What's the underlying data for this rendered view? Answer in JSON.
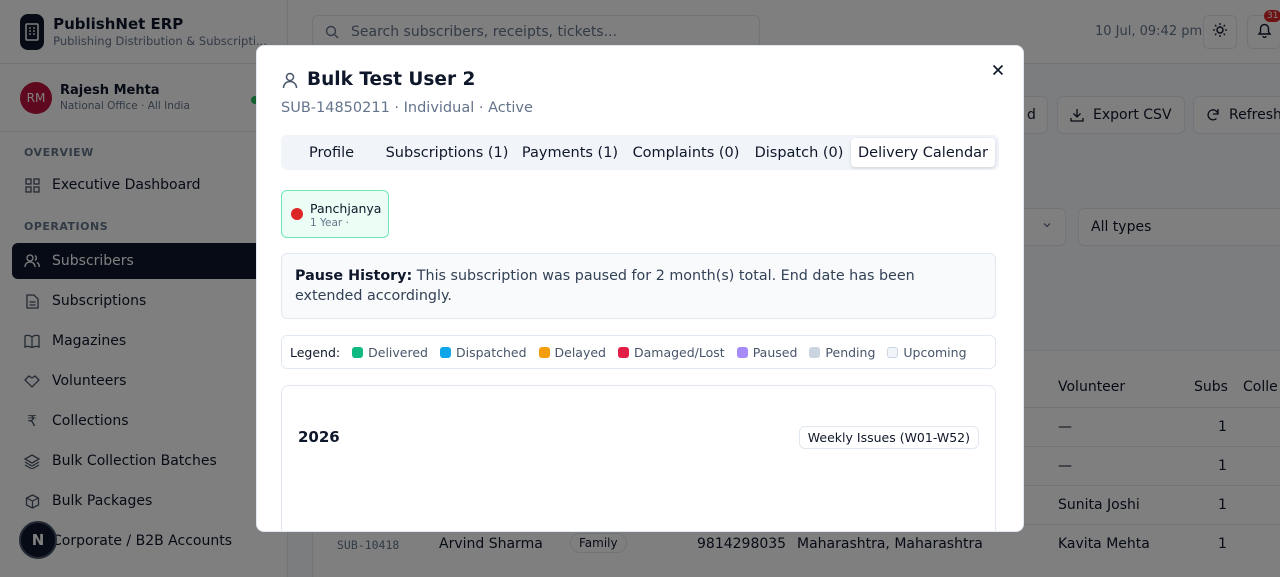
{
  "app": {
    "name": "PublishNet ERP",
    "subtitle": "Publishing Distribution & Subscripti..."
  },
  "user": {
    "initials": "RM",
    "name": "Rajesh Mehta",
    "role": "National Office · All India"
  },
  "sidebar": {
    "overview_label": "OVERVIEW",
    "operations_label": "OPERATIONS",
    "items": [
      {
        "label": "Executive Dashboard",
        "icon": "dashboard-icon"
      },
      {
        "label": "Subscribers",
        "icon": "users-icon",
        "active": true
      },
      {
        "label": "Subscriptions",
        "icon": "document-icon"
      },
      {
        "label": "Magazines",
        "icon": "book-icon"
      },
      {
        "label": "Volunteers",
        "icon": "handshake-icon"
      },
      {
        "label": "Collections",
        "icon": "rupee-icon"
      },
      {
        "label": "Bulk Collection Batches",
        "icon": "layers-icon"
      },
      {
        "label": "Bulk Packages",
        "icon": "package-icon"
      },
      {
        "label": "Corporate / B2B Accounts",
        "icon": "building-icon"
      }
    ]
  },
  "fab_label": "N",
  "topbar": {
    "search_placeholder": "Search subscribers, receipts, tickets...",
    "datetime": "10 Jul, 09:42 pm",
    "notification_count": "31"
  },
  "page": {
    "action_partial": "d",
    "export_label": "Export CSV",
    "refresh_label": "Refresh",
    "filter_types": "All types"
  },
  "table": {
    "headers": {
      "volunteer": "Volunteer",
      "subs": "Subs",
      "collections": "Colle"
    },
    "rows": [
      {
        "volunteer": "—",
        "subs": "1"
      },
      {
        "volunteer": "—",
        "subs": "1"
      },
      {
        "volunteer": "Sunita Joshi",
        "subs": "1"
      },
      {
        "id": "SUB-10418",
        "name": "Arvind Sharma",
        "type": "Family",
        "phone": "9814298035",
        "location": "Maharashtra, Maharashtra",
        "volunteer": "Kavita Mehta",
        "subs": "1"
      }
    ]
  },
  "modal": {
    "title": "Bulk Test User 2",
    "subtitle": "SUB-14850211 · Individual · Active",
    "tabs": [
      {
        "label": "Profile"
      },
      {
        "label": "Subscriptions (1)"
      },
      {
        "label": "Payments (1)"
      },
      {
        "label": "Complaints (0)"
      },
      {
        "label": "Dispatch (0)"
      },
      {
        "label": "Delivery Calendar",
        "active": true
      }
    ],
    "magazine": {
      "name": "Panchjanya",
      "meta": "1 Year ·",
      "color": "#dc2626"
    },
    "pause": {
      "heading": "Pause History:",
      "text": "This subscription was paused for 2 month(s) total. End date has been extended accordingly."
    },
    "legend": {
      "label": "Legend:",
      "items": [
        {
          "label": "Delivered",
          "color": "#10b981"
        },
        {
          "label": "Dispatched",
          "color": "#0ea5e9"
        },
        {
          "label": "Delayed",
          "color": "#f59e0b"
        },
        {
          "label": "Damaged/Lost",
          "color": "#e11d48"
        },
        {
          "label": "Paused",
          "color": "#a78bfa"
        },
        {
          "label": "Pending",
          "color": "#cbd5e1"
        },
        {
          "label": "Upcoming",
          "color": "#f1f5f9"
        }
      ]
    },
    "calendar": {
      "year": "2026",
      "issues_label": "Weekly Issues (W01-W52)"
    }
  }
}
